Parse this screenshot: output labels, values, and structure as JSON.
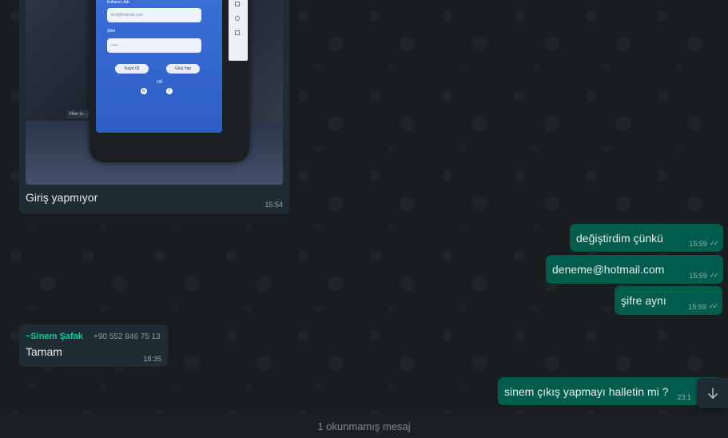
{
  "image_message": {
    "caption": "Giriş yapmıyor",
    "time": "15:54",
    "screen": {
      "username_label": "Kullanıcı Adı",
      "username_value": "test@hotmail.com",
      "password_label": "Şifre",
      "password_value": "•••••",
      "register_btn": "Kayıt Ol",
      "login_btn": "Giriş Yap",
      "or_text": "OR",
      "google": "G",
      "facebook": "f",
      "filter_tag": "Filter (e..."
    }
  },
  "outgoing": [
    {
      "text": "değiştirdim çünkü",
      "time": "15:59"
    },
    {
      "text": "deneme@hotmail.com",
      "time": "15:59"
    },
    {
      "text": "şifre aynı",
      "time": "15:59"
    },
    {
      "text": "sinem çıkış yapmayı halletin mi ?",
      "time": "23:1"
    }
  ],
  "incoming": {
    "sender": "~Sinem Şafak",
    "phone": "+90 552 846 75 13",
    "text": "Tamam",
    "time": "18:35"
  },
  "unread_bar": "1 okunmamış mesaj",
  "icons": {
    "read_tick": "double-check-icon",
    "scroll_down": "arrow-down-icon"
  },
  "colors": {
    "outgoing": "#005c4b",
    "incoming": "#202c33",
    "sender": "#06cf9c"
  }
}
